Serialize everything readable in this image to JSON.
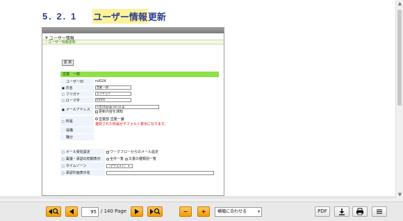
{
  "document": {
    "heading_number": "5. 2. 1",
    "heading_highlight": "ユーザー情報",
    "heading_rest": "更新"
  },
  "screenshot": {
    "tab_title": "ユーザー情報",
    "breadcrumb": "・ユーザー情報更新",
    "update_button": "更 新",
    "section_title": "営業　一郎",
    "fields": {
      "user_id_label": "ユーザーID",
      "user_id_value": "rsi024",
      "name_label": "氏名",
      "name_value": "営業 一郎",
      "furigana_label": "フリガナ",
      "furigana_value": "エイギョウ",
      "roman_label": "ローマ字",
      "roman_value": "EIGYO",
      "email_label": "メールアドレス",
      "email_value": "rsi024@xgr.sei.co.jp",
      "email_notify": "更新内容を通知",
      "affiliation_label": "所属",
      "affiliation_value": "営業部 営業一課",
      "affiliation_note": "選択された所属がデフォルト表示になります。",
      "position_label": "役職",
      "role_label": "職分",
      "mail_recv_label": "メール受信設定",
      "mail_recv_value": "ワークフローからのメール設定",
      "approval_label": "稟議・承認の初期表示",
      "approval_opt1": "全件一覧",
      "approval_opt2": "文書の種類別一覧",
      "timezone_label": "タイムゾーン",
      "timezone_value": "（デフォルト）",
      "approver_label": "承認印画表示名"
    }
  },
  "toolbar": {
    "current_page": "95",
    "page_info": "/ 140 Page",
    "zoom_mode": "横幅に合わせる",
    "pdf_label": "PDF",
    "zoom_out_label": "−",
    "zoom_in_label": "+"
  },
  "colors": {
    "heading": "#2e3f8f",
    "highlight": "#fbf29a",
    "section_green": "#8fe04a",
    "toolbar_orange": "#f39a00"
  }
}
